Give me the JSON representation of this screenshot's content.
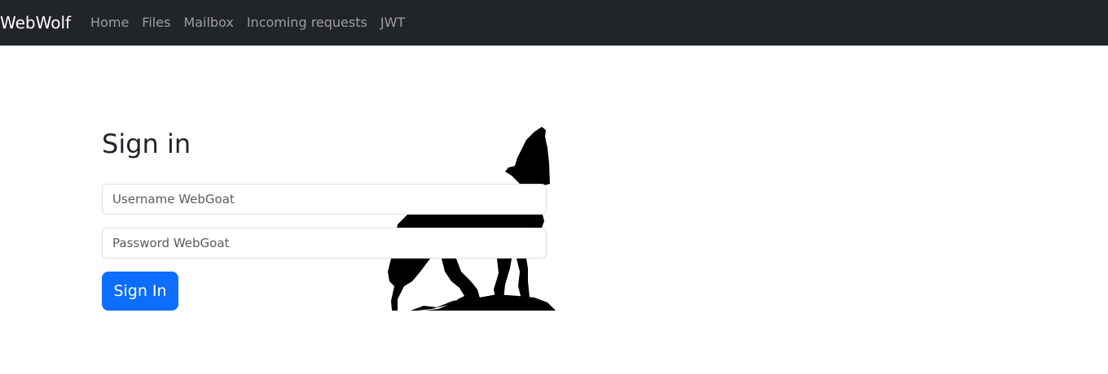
{
  "navbar": {
    "brand": "WebWolf",
    "links": [
      {
        "label": "Home"
      },
      {
        "label": "Files"
      },
      {
        "label": "Mailbox"
      },
      {
        "label": "Incoming requests"
      },
      {
        "label": "JWT"
      }
    ]
  },
  "login": {
    "title": "Sign in",
    "username": {
      "value": "",
      "placeholder": "Username WebGoat"
    },
    "password": {
      "value": "",
      "placeholder": "Password WebGoat"
    },
    "submit_label": "Sign In"
  },
  "illustration": {
    "icon": "howling-wolf-silhouette"
  },
  "colors": {
    "navbar_bg": "#212529",
    "primary": "#0d6efd",
    "nav_link": "#8c8f92"
  }
}
